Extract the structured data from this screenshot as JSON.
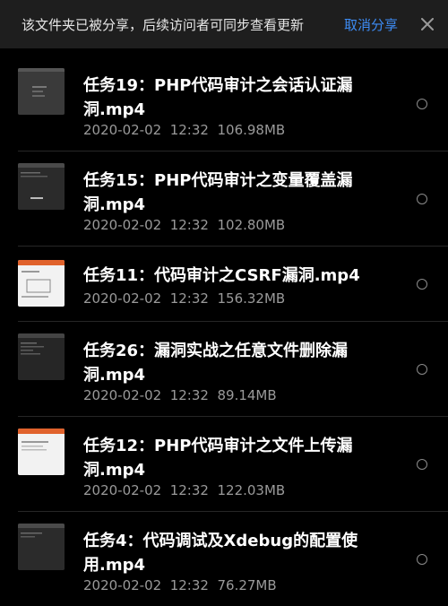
{
  "banner": {
    "message": "该文件夹已被分享，后续访问者可同步查看更新",
    "cancel_label": "取消分享",
    "close_icon": "close-icon"
  },
  "files": [
    {
      "title": "任务19：PHP代码审计之会话认证漏洞.mp4",
      "date": "2020-02-02  12:32",
      "size": "106.98MB",
      "thumb": "dark-doc"
    },
    {
      "title": "任务15：PHP代码审计之变量覆盖漏洞.mp4",
      "date": "2020-02-02  12:32",
      "size": "102.80MB",
      "thumb": "dark-terminal"
    },
    {
      "title": "任务11：代码审计之CSRF漏洞.mp4",
      "date": "2020-02-02  12:32",
      "size": "156.32MB",
      "thumb": "slide-orange"
    },
    {
      "title": "任务26：漏洞实战之任意文件删除漏洞.mp4",
      "date": "2020-02-02  12:32",
      "size": "89.14MB",
      "thumb": "dark-terminal"
    },
    {
      "title": "任务12：PHP代码审计之文件上传漏洞.mp4",
      "date": "2020-02-02  12:32",
      "size": "122.03MB",
      "thumb": "slide-orange"
    },
    {
      "title": "任务4：代码调试及Xdebug的配置使用.mp4",
      "date": "2020-02-02  12:32",
      "size": "76.27MB",
      "thumb": "dark-terminal"
    }
  ],
  "colors": {
    "accent": "#3d8cf5",
    "background": "#000000",
    "banner": "#1e1e1e",
    "meta_text": "#9a9a9a"
  }
}
